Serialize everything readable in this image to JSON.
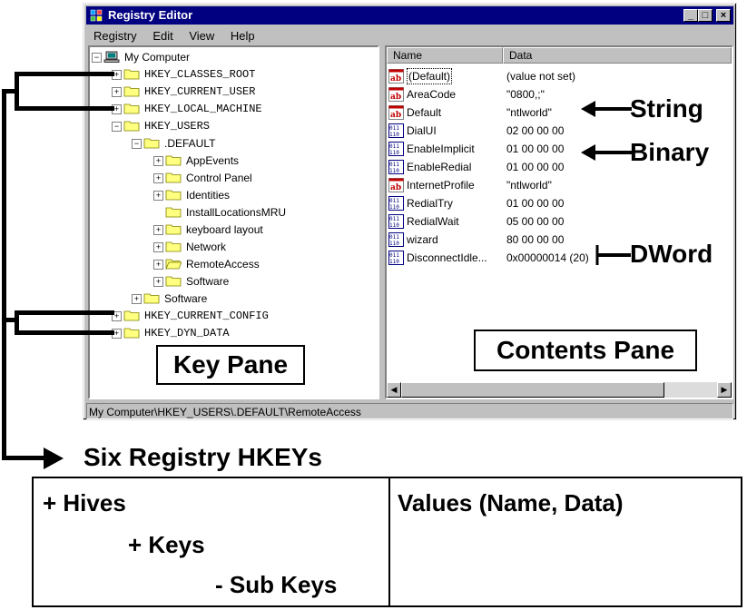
{
  "window": {
    "title": "Registry Editor",
    "menu": [
      "Registry",
      "Edit",
      "View",
      "Help"
    ],
    "controls": {
      "minimize": "_",
      "maximize": "□",
      "close": "×"
    }
  },
  "tree": [
    {
      "label": "My Computer",
      "level": 0,
      "expander": "−",
      "icon": "computer-icon"
    },
    {
      "label": "HKEY_CLASSES_ROOT",
      "level": 1,
      "expander": "+",
      "icon": "folder-icon"
    },
    {
      "label": "HKEY_CURRENT_USER",
      "level": 1,
      "expander": "+",
      "icon": "folder-icon"
    },
    {
      "label": "HKEY_LOCAL_MACHINE",
      "level": 1,
      "expander": "+",
      "icon": "folder-icon"
    },
    {
      "label": "HKEY_USERS",
      "level": 1,
      "expander": "−",
      "icon": "folder-icon"
    },
    {
      "label": ".DEFAULT",
      "level": 2,
      "expander": "−",
      "icon": "folder-icon"
    },
    {
      "label": "AppEvents",
      "level": 3,
      "expander": "+",
      "icon": "folder-icon"
    },
    {
      "label": "Control Panel",
      "level": 3,
      "expander": "+",
      "icon": "folder-icon"
    },
    {
      "label": "Identities",
      "level": 3,
      "expander": "+",
      "icon": "folder-icon"
    },
    {
      "label": "InstallLocationsMRU",
      "level": 3,
      "expander": "",
      "icon": "folder-icon"
    },
    {
      "label": "keyboard layout",
      "level": 3,
      "expander": "+",
      "icon": "folder-icon"
    },
    {
      "label": "Network",
      "level": 3,
      "expander": "+",
      "icon": "folder-icon"
    },
    {
      "label": "RemoteAccess",
      "level": 3,
      "expander": "+",
      "icon": "open-folder-icon"
    },
    {
      "label": "Software",
      "level": 3,
      "expander": "+",
      "icon": "folder-icon"
    },
    {
      "label": "Software",
      "level": 2,
      "expander": "+",
      "icon": "folder-icon"
    },
    {
      "label": "HKEY_CURRENT_CONFIG",
      "level": 1,
      "expander": "+",
      "icon": "folder-icon"
    },
    {
      "label": "HKEY_DYN_DATA",
      "level": 1,
      "expander": "+",
      "icon": "folder-icon"
    }
  ],
  "contents": {
    "columns": [
      "Name",
      "Data"
    ],
    "rows": [
      {
        "name": "(Default)",
        "data": "(value not set)",
        "type": "string"
      },
      {
        "name": "AreaCode",
        "data": "\"0800,;\"",
        "type": "string"
      },
      {
        "name": "Default",
        "data": "\"ntlworld\"",
        "type": "string"
      },
      {
        "name": "DialUI",
        "data": "02 00 00 00",
        "type": "binary"
      },
      {
        "name": "EnableImplicit",
        "data": "01 00 00 00",
        "type": "binary"
      },
      {
        "name": "EnableRedial",
        "data": "01 00 00 00",
        "type": "binary"
      },
      {
        "name": "InternetProfile",
        "data": "\"ntlworld\"",
        "type": "string"
      },
      {
        "name": "RedialTry",
        "data": "01 00 00 00",
        "type": "binary"
      },
      {
        "name": "RedialWait",
        "data": "05 00 00 00",
        "type": "binary"
      },
      {
        "name": "wizard",
        "data": "80 00 00 00",
        "type": "binary"
      },
      {
        "name": "DisconnectIdle...",
        "data": "0x00000014 (20)",
        "type": "binary"
      }
    ]
  },
  "status": "My Computer\\HKEY_USERS\\.DEFAULT\\RemoteAccess",
  "annotations": {
    "string": "String",
    "binary": "Binary",
    "dword": "DWord",
    "key_pane": "Key Pane",
    "contents_pane": "Contents Pane",
    "six_hkeys": "Six Registry HKEYs"
  },
  "bottom_table": {
    "left": [
      "+ Hives",
      "+ Keys",
      "- Sub Keys"
    ],
    "right": "Values (Name, Data)"
  },
  "colors": {
    "titlebar": "#000080",
    "chrome": "#c0c0c0",
    "folder": "#ffff80"
  }
}
